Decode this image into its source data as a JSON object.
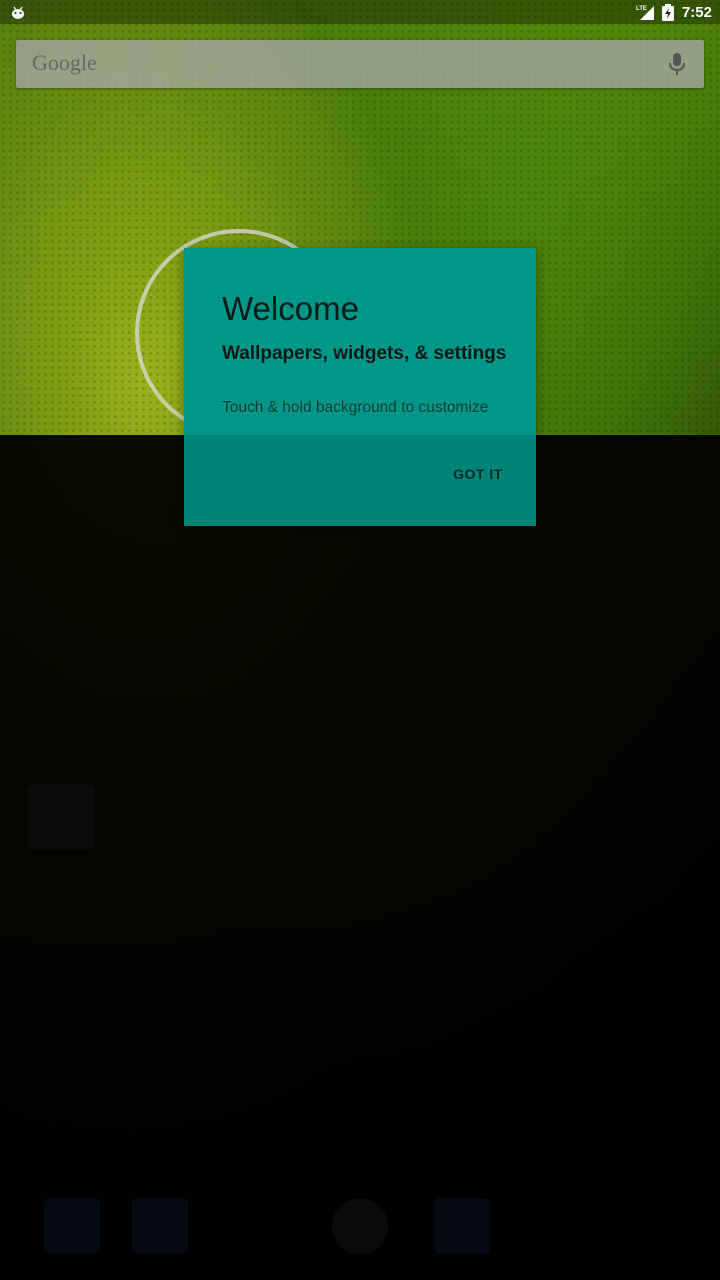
{
  "status_bar": {
    "time": "7:52",
    "network": "LTE",
    "icons": [
      "android-notification-icon",
      "lte-signal-icon",
      "battery-charging-icon"
    ]
  },
  "search": {
    "logo": "Google",
    "mic_icon": "mic-icon"
  },
  "welcome_card": {
    "title": "Welcome",
    "subtitle": "Wallpapers, widgets, & settings",
    "description": "Touch & hold background to customize",
    "button_label": "GOT IT"
  },
  "colors": {
    "card_background": "#009688",
    "overlay": "#000000",
    "wallpaper_green": "#3f6a08"
  }
}
